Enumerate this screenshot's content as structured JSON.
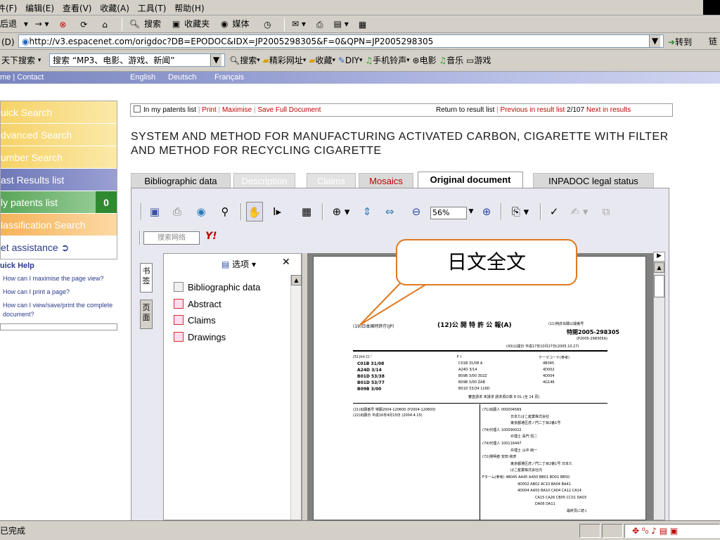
{
  "browser": {
    "menu": [
      "件(F)",
      "编辑(E)",
      "查看(V)",
      "收藏(A)",
      "工具(T)",
      "帮助(H)"
    ],
    "toolbar": {
      "back": "后退",
      "search": "搜索",
      "favorites": "收藏夹",
      "media": "媒体"
    },
    "address": {
      "label": "(D)",
      "url": "http://v3.espacenet.com/origdoc?DB=EPODOC&IDX=JP2005298305&F=0&QPN=JP2005298305",
      "go": "转到",
      "links": "链"
    },
    "links_bar": {
      "search_label": "天下搜索",
      "search_value": "搜索 “MP3、电影、游戏、新闻”",
      "items": [
        "搜索",
        "精彩网址",
        "收藏",
        "DIY",
        "手机铃声",
        "电影",
        "音乐",
        "游戏"
      ]
    },
    "status": "已完成"
  },
  "site": {
    "header_left": "me | Contact",
    "languages": [
      "English",
      "Deutsch",
      "Français"
    ],
    "nav": [
      {
        "label": "uick Search",
        "color": "#f2c84b"
      },
      {
        "label": "dvanced Search",
        "color": "#f2c84b"
      },
      {
        "label": "umber Search",
        "color": "#f2c84b"
      },
      {
        "label": "ast Results list",
        "color": "#6f78b8"
      },
      {
        "label": "ly patents list",
        "color": "#4f9a4f",
        "badge": "0"
      },
      {
        "label": "lassification Search",
        "color": "#f2a54b"
      },
      {
        "label": "et assistance",
        "color": "#ffffff"
      }
    ],
    "quick_help": {
      "title": "uick Help",
      "links": [
        "How can I maximise the page view?",
        "How can I print a page?",
        "How can I view/save/print the complete document?"
      ]
    }
  },
  "document": {
    "options": {
      "my_patents": "In my patents list",
      "print": "Print",
      "maximise": "Maximise",
      "save": "Save Full Document",
      "return": "Return to result list",
      "previous": "Previous in result list",
      "counter": "2/107",
      "next": "Next in results"
    },
    "title": "SYSTEM AND METHOD FOR MANUFACTURING ACTIVATED CARBON, CIGARETTE WITH FILTER AND METHOD FOR RECYCLING CIGARETTE",
    "tabs": [
      "Bibliographic data",
      "Description",
      "Claims",
      "Mosaics",
      "Original document",
      "INPADOC legal status"
    ]
  },
  "viewer": {
    "zoom": "56%",
    "search_placeholder": "搜索网络",
    "options_label": "选项",
    "side_tabs": [
      "书签",
      "页面"
    ],
    "bookmarks": [
      "Bibliographic data",
      "Abstract",
      "Claims",
      "Drawings"
    ]
  },
  "callout": "日文全文",
  "patent_page": {
    "header_left": "(19)日本国特許庁(JP)",
    "header_center": "(12)公 開 特 許 公 報(A)",
    "pub_label": "(11)特許出願公開番号",
    "pub_number": "特開2005-298305",
    "pub_alt": "(P2005-298305A)",
    "pub_date": "(43)公開日  平成17年10月27日(2005.10.27)",
    "int_cl_label": "(51)Int.Cl.⁷",
    "fi_label": "F I",
    "theme_label": "テーマコード(参考)",
    "ipc": [
      "C01B 31/08",
      "A24D 3/14",
      "B01D 53/38",
      "B01D 53/77",
      "B09B 3/00"
    ],
    "fi": [
      "C01B 31/08  A",
      "A24D 3/14",
      "B09B 3/00  302Z",
      "B09B 3/00  ZAB",
      "B01D 53/34  116D"
    ],
    "theme": [
      "4B045",
      "4D002",
      "4D004",
      "4G146"
    ],
    "exam": "審査請求 未請求  請求項の数 8  OL  (全 14 頁)",
    "app_no_label": "(21)出願番号",
    "app_no": "特願2004-120600 (P2004-120600)",
    "app_date_label": "(22)出願日",
    "app_date": "平成16年4月15日 (2004.4.15)",
    "right_lines": [
      "(71)出願人  000004569",
      "日本たばこ産業株式会社",
      "東京都港区虎ノ門二丁目2番1号",
      "(74)代理人  100090022",
      "弁理士  長門  侃二",
      "(74)代理人  100116447",
      "弁理士  山中  純一",
      "(72)発明者  安田  和彦",
      "東京都港区虎ノ門二丁目2番1号  日本た",
      "ばこ産業株式会社内",
      "Fターム(参考) 4B045 AA45  AA50  BB01  BD01  BB50",
      "4D002 AB02  AC10  BA04  BA41",
      "4D004 AA50  BA10  CA04  CA12  CA14",
      "CA15  CA26  CB05  CC01  DA03",
      "DA06  DA11",
      "最終頁に続く"
    ]
  }
}
